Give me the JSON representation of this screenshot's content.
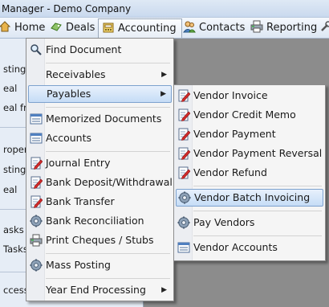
{
  "titlebar": {
    "title": "Manager - Demo Company"
  },
  "menubar": {
    "items": [
      {
        "label": "Home",
        "icon": "home-icon"
      },
      {
        "label": "Deals",
        "icon": "deals-icon"
      },
      {
        "label": "Accounting",
        "icon": "accounting-icon"
      },
      {
        "label": "Contacts",
        "icon": "contacts-icon"
      },
      {
        "label": "Reporting",
        "icon": "printer-icon"
      }
    ]
  },
  "leftpanel": {
    "rows": [
      "sting",
      "eal",
      "eal fro",
      "ropert",
      "sting",
      "eal",
      "asks",
      "Tasks",
      "ccessed"
    ]
  },
  "accounting_menu": {
    "items": [
      {
        "label": "Find Document",
        "icon": "search-icon"
      },
      {
        "label": "Receivables",
        "submenu": true
      },
      {
        "label": "Payables",
        "submenu": true,
        "highlighted": true
      },
      {
        "label": "Memorized Documents",
        "icon": "list-icon"
      },
      {
        "label": "Accounts",
        "icon": "list-icon"
      },
      {
        "label": "Journal Entry",
        "icon": "document-pencil-icon"
      },
      {
        "label": "Bank Deposit/Withdrawal",
        "icon": "document-pencil-icon"
      },
      {
        "label": "Bank Transfer",
        "icon": "document-pencil-icon"
      },
      {
        "label": "Bank Reconciliation",
        "icon": "gear-icon"
      },
      {
        "label": "Print Cheques / Stubs",
        "icon": "printer-icon"
      },
      {
        "label": "Mass Posting",
        "icon": "gear-icon"
      },
      {
        "label": "Year End Processing",
        "submenu": true
      }
    ]
  },
  "payables_menu": {
    "items": [
      {
        "label": "Vendor Invoice",
        "icon": "document-pencil-icon"
      },
      {
        "label": "Vendor Credit Memo",
        "icon": "document-pencil-icon"
      },
      {
        "label": "Vendor Payment",
        "icon": "document-pencil-icon"
      },
      {
        "label": "Vendor Payment Reversal",
        "icon": "document-pencil-icon"
      },
      {
        "label": "Vendor Refund",
        "icon": "document-pencil-icon"
      },
      {
        "label": "Vendor Batch Invoicing",
        "icon": "gear-icon",
        "highlighted": true
      },
      {
        "label": "Pay Vendors",
        "icon": "gear-icon"
      },
      {
        "label": "Vendor Accounts",
        "icon": "list-icon"
      }
    ]
  },
  "colors": {
    "highlight_border": "#7da2ce",
    "highlight_fill": "#c5dcf6",
    "menu_bg": "#f5f5f5",
    "background": "#8c8c8c"
  }
}
